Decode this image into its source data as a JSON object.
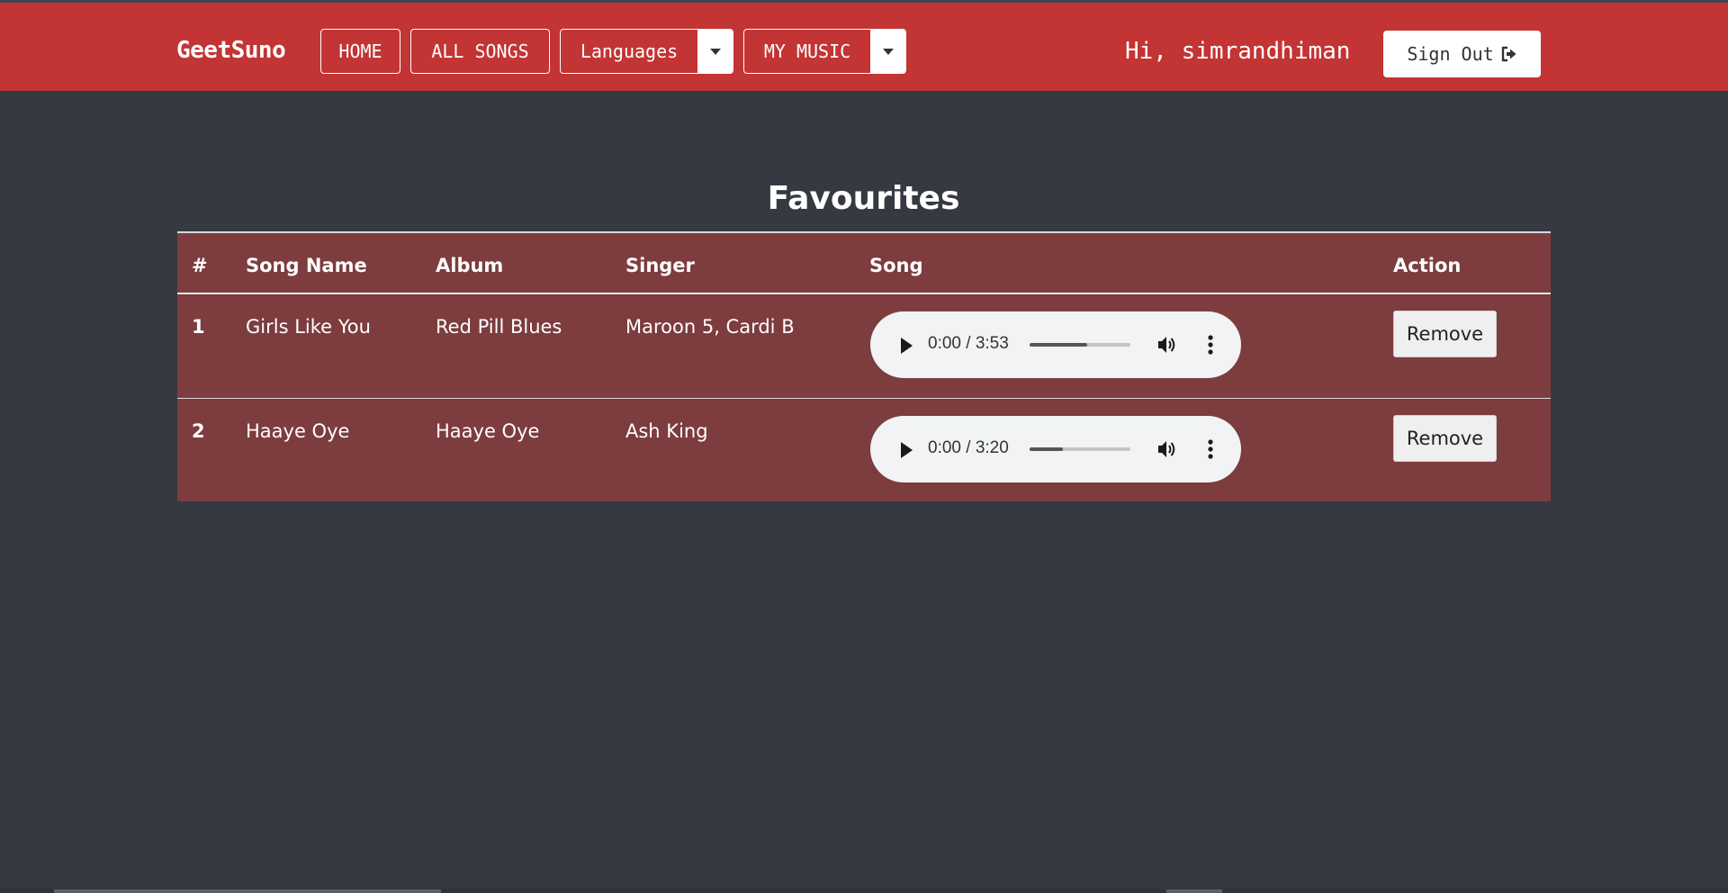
{
  "brand": "GeetSuno",
  "nav": {
    "home": "HOME",
    "all_songs": "ALL SONGS",
    "languages": "Languages",
    "my_music": "MY MUSIC"
  },
  "user": {
    "greeting": "Hi, simrandhiman",
    "sign_out": "Sign Out"
  },
  "page": {
    "title": "Favourites"
  },
  "table": {
    "headers": [
      "#",
      "Song Name",
      "Album",
      "Singer",
      "Song",
      "Action"
    ],
    "rows": [
      {
        "num": "1",
        "song": "Girls Like You",
        "album": "Red Pill Blues",
        "singer": "Maroon 5, Cardi B",
        "time": "0:00 / 3:53",
        "volume_level": 0.57,
        "action": "Remove"
      },
      {
        "num": "2",
        "song": "Haaye Oye",
        "album": "Haaye Oye",
        "singer": "Ash King",
        "time": "0:00 / 3:20",
        "volume_level": 0.33,
        "action": "Remove"
      }
    ]
  },
  "colors": {
    "navbar": "#c33434",
    "background": "#353941",
    "table": "#7d3c3e"
  },
  "icons": [
    "caret-down-icon",
    "sign-out-icon",
    "play-icon",
    "volume-icon",
    "more-options-icon"
  ]
}
